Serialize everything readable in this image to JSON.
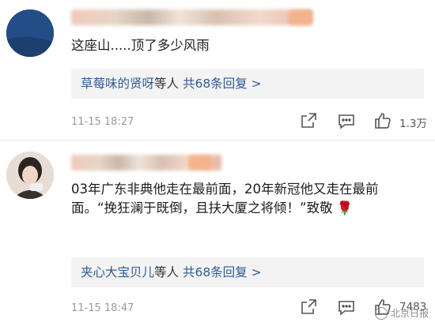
{
  "comments": [
    {
      "text": "这座山.....顶了多少风雨",
      "reply_users": "草莓味的贤呀",
      "reply_suffix": "等人 ",
      "reply_count_text": "共68条回复 >",
      "time": "11-15 18:27",
      "like_count": "1.3万"
    },
    {
      "text": "03年广东非典他走在最前面，20年新冠他又走在最前面。“挽狂澜于既倒，且扶大厦之将倾！”致敬 🌹",
      "reply_users": "夹心大宝贝儿",
      "reply_suffix": "等人 ",
      "reply_count_text": "共68条回复 >",
      "time": "11-15 18:47",
      "like_count": "7483"
    }
  ],
  "watermark": "北京日报",
  "icons": [
    "share-icon",
    "comment-icon",
    "like-icon"
  ]
}
